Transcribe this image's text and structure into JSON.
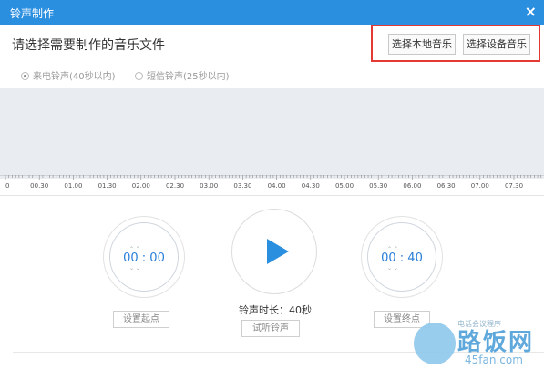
{
  "window": {
    "title": "铃声制作",
    "close_icon": "×"
  },
  "header": {
    "heading": "请选择需要制作的音乐文件",
    "btn_local": "选择本地音乐",
    "btn_device": "选择设备音乐"
  },
  "ringtone_types": [
    {
      "label": "来电铃声(40秒以内)",
      "selected": true
    },
    {
      "label": "短信铃声(25秒以内)",
      "selected": false
    }
  ],
  "timeline": {
    "ticks": [
      "0",
      "00.30",
      "01.00",
      "01.30",
      "02.00",
      "02.30",
      "03.00",
      "03.30",
      "04.00",
      "04.30",
      "05.00",
      "05.30",
      "06.00",
      "06.30",
      "07.00",
      "07.30"
    ]
  },
  "start": {
    "time": "00 : 00",
    "button": "设置起点"
  },
  "end": {
    "time": "00 : 40",
    "button": "设置终点"
  },
  "play": {
    "duration_label": "铃声时长：40秒",
    "preview_button": "试听铃声"
  },
  "watermark": {
    "text": "路饭网",
    "url": "45fan.com",
    "mini": "电话会议程序"
  },
  "colors": {
    "accent": "#2b8fe0",
    "highlight": "#e53935",
    "wave_bg": "#e9ecf1"
  }
}
